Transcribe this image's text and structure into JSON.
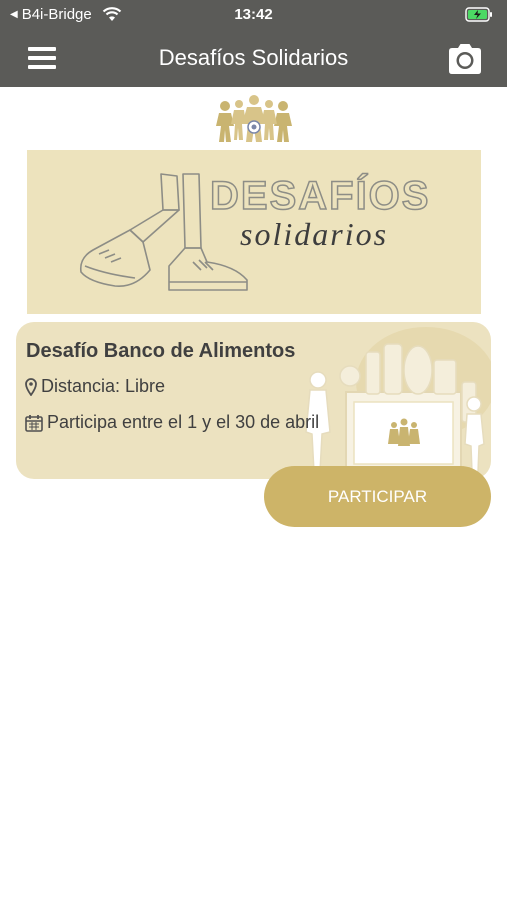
{
  "status_bar": {
    "back_label": "B4i-Bridge",
    "time": "13:42"
  },
  "nav": {
    "title": "Desafíos Solidarios"
  },
  "banner": {
    "title": "DESAFÍOS",
    "subtitle": "solidarios"
  },
  "challenge": {
    "title": "Desafío Banco de Alimentos",
    "distance": "Distancia: Libre",
    "dates": "Participa entre el 1 y el 30 de abril"
  },
  "actions": {
    "participate_label": "PARTICIPAR"
  },
  "colors": {
    "header_bg": "#5b5b58",
    "banner_bg": "#ede3bd",
    "card_bg": "#ece2c0",
    "accent_gold": "#cdb468",
    "text_dark": "#404040"
  },
  "icons": {
    "wifi": "wifi-icon",
    "battery": "battery-charging-icon",
    "menu": "hamburger-menu-icon",
    "camera": "camera-icon",
    "location": "map-marker-icon",
    "calendar": "calendar-icon"
  }
}
